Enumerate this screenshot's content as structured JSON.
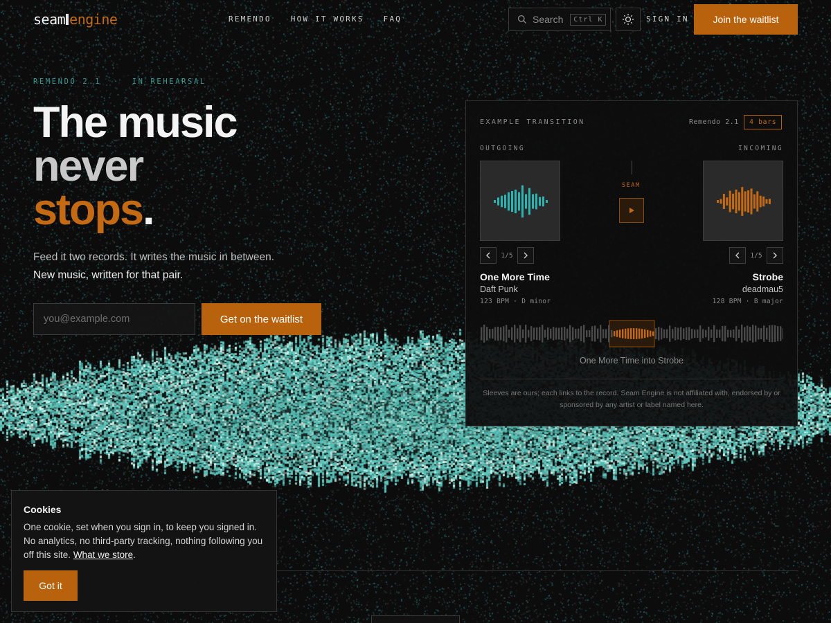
{
  "brand": {
    "logo_part1": "seam",
    "logo_part2": "engine"
  },
  "nav": {
    "items": [
      "REMENDO",
      "HOW IT WORKS",
      "FAQ"
    ]
  },
  "search": {
    "placeholder": "Search",
    "shortcut": "Ctrl K",
    "icon": "search-icon"
  },
  "header": {
    "theme_icon": "sun-icon",
    "sign_in": "SIGN IN",
    "join_label": "Join the waitlist"
  },
  "hero": {
    "eyebrow": "REMENDO 2.1  ·  IN REHEARSAL",
    "headline_line1": "The music",
    "headline_line2": "never",
    "headline_line3": "stops",
    "headline_punct": ".",
    "sub_line1": "Feed it two records. It writes the music in between.",
    "sub_line2": "New music, written for that pair.",
    "email_placeholder": "you@example.com",
    "cta_label": "Get on the waitlist"
  },
  "example": {
    "title": "EXAMPLE TRANSITION",
    "version": "Remendo 2.1",
    "length_badge": "4 bars",
    "outgoing_label": "OUTGOING",
    "incoming_label": "INCOMING",
    "seam_label": "SEAM",
    "outgoing": {
      "title": "One More Time",
      "artist": "Daft Punk",
      "meta": "123 BPM · D minor",
      "page": "1/5"
    },
    "incoming": {
      "title": "Strobe",
      "artist": "deadmau5",
      "meta": "128 BPM · B major",
      "page": "1/5"
    },
    "caption": "One More Time into Strobe",
    "disclaimer": "Sleeves are ours; each links to the record. Seam Engine is not affiliated with, endorsed by or sponsored by any artist or label named here."
  },
  "cookie": {
    "title": "Cookies",
    "body": "One cookie, set when you sign in, to keep you signed in. No analytics, no third-party tracking, nothing following you off this site.",
    "link": "What we store",
    "link_suffix": ".",
    "button": "Got it"
  },
  "colors": {
    "accent": "#b8620d",
    "teal": "#2bb5b2",
    "orange": "#c46a12",
    "background": "#0c0c0c"
  }
}
